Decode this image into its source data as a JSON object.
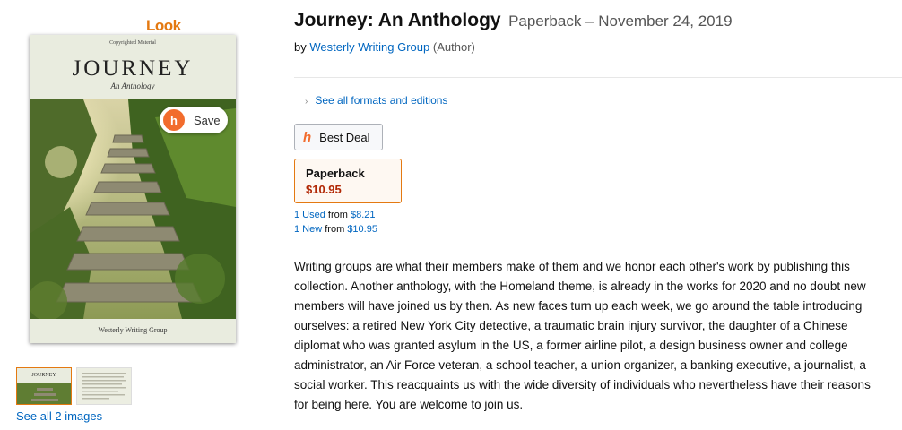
{
  "look_inside": {
    "label": "Look inside",
    "arrow": "↴"
  },
  "cover": {
    "copyright_text": "Copyrighted Material",
    "title": "JOURNEY",
    "subtitle": "An Anthology",
    "author": "Westerly Writing Group",
    "icon": "book-cover-stone-stairs-garden"
  },
  "save": {
    "icon_glyph": "h",
    "label": "Save"
  },
  "thumbnails": {
    "see_all_label": "See all 2 images",
    "mini_title": "JOURNEY"
  },
  "product": {
    "title": "Journey: An Anthology",
    "format_date": "Paperback – November 24, 2019",
    "by_label": "by",
    "author": "Westerly Writing Group",
    "author_role": "(Author)"
  },
  "formats_link": "See all formats and editions",
  "best_deal": {
    "icon_glyph": "h",
    "label": "Best Deal"
  },
  "swatch": {
    "format": "Paperback",
    "price": "$10.95"
  },
  "offers": [
    {
      "link": "1 Used",
      "from": "from",
      "price": "$8.21"
    },
    {
      "link": "1 New",
      "from": "from",
      "price": "$10.95"
    }
  ],
  "description": "Writing groups are what their members make of them and we honor each other's work by publishing this collection. Another anthology, with the Homeland theme, is already in the works for 2020 and no doubt new members will have joined us by then. As new faces turn up each week, we go around the table introducing ourselves: a retired New York City detective, a traumatic brain injury survivor, the daughter of a Chinese diplomat who was granted asylum in the US, a former airline pilot, a design business owner and college administrator, an Air Force veteran, a school teacher, a union organizer, a banking executive, a journalist, a social worker. This reacquaints us with the wide diversity of individuals who nevertheless have their reasons for being here. You are welcome to join us.",
  "colors": {
    "accent_orange": "#e47911",
    "link_blue": "#0066c0",
    "price_red": "#b12704",
    "honey_orange": "#f26c2d"
  }
}
